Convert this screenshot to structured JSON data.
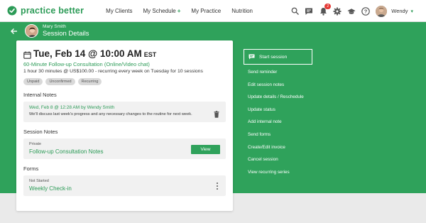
{
  "brand": {
    "name": "practice better",
    "accent": "#2c9b57"
  },
  "nav": {
    "items": [
      {
        "label": "My Clients"
      },
      {
        "label": "My Schedule",
        "plus": "+"
      },
      {
        "label": "My Practice"
      },
      {
        "label": "Nutrition"
      }
    ]
  },
  "topbar": {
    "icons": [
      "search-icon",
      "chat-icon",
      "notification-icon",
      "gear-icon",
      "graduation-cap-icon",
      "help-icon"
    ],
    "notification_count": "2",
    "user_name": "Wendy"
  },
  "header": {
    "client_name": "Mary Smith",
    "title": "Session Details"
  },
  "session": {
    "date": "Tue, Feb 14 @ 10:00 AM",
    "timezone": "EST",
    "consult_name": "60-Minute Follow-up Consultation",
    "consult_mode": "(Online/Video chat)",
    "details": "1 hour 30 minutes @ US$100.00 - recurring every week on Tuesday for 10 sessions",
    "tags": [
      "Unpaid",
      "Unconfirmed",
      "Recurring"
    ]
  },
  "internal_notes": {
    "label": "Internal Notes",
    "meta": "Wed, Feb 8 @ 12:28 AM by Wendy Smith",
    "body": "We'll discuss last week's progress and any necessary changes to the routine for next week."
  },
  "session_notes": {
    "label": "Session Notes",
    "sub": "Private",
    "title": "Follow-up Consultation Notes",
    "button": "View"
  },
  "forms": {
    "label": "Forms",
    "status": "Not Started",
    "title": "Weekly Check-in"
  },
  "actions": {
    "start": "Start session",
    "items": [
      "Send reminder",
      "Edit session notes",
      "Update details / Reschedule",
      "Update status",
      "Add internal note",
      "Send forms",
      "Create/Edit invoice",
      "Cancel session",
      "View recurring series"
    ]
  }
}
